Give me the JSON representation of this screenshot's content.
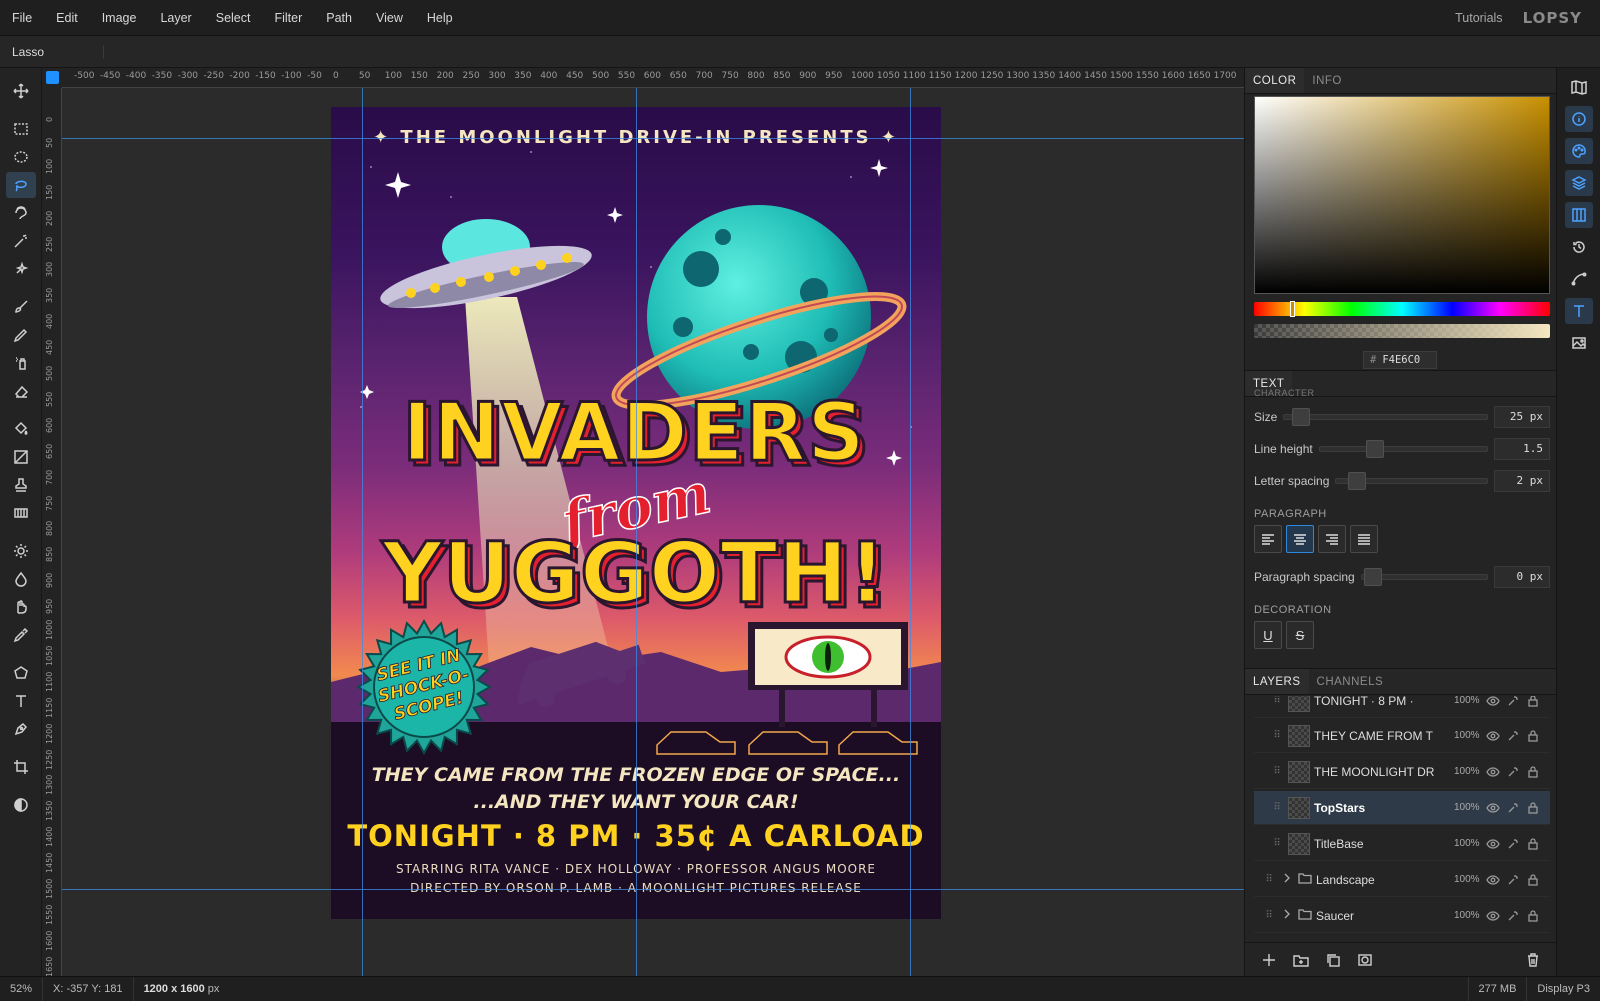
{
  "menubar": {
    "items": [
      "File",
      "Edit",
      "Image",
      "Layer",
      "Select",
      "Filter",
      "Path",
      "View",
      "Help"
    ],
    "tutorials": "Tutorials",
    "logo": "LOPSY"
  },
  "options": {
    "tool_name": "Lasso"
  },
  "rulers": {
    "h": [
      "-500",
      "-450",
      "-400",
      "-350",
      "-300",
      "-250",
      "-200",
      "-150",
      "-100",
      "-50",
      "0",
      "50",
      "100",
      "150",
      "200",
      "250",
      "300",
      "350",
      "400",
      "450",
      "500",
      "550",
      "600",
      "650",
      "700",
      "750",
      "800",
      "850",
      "900",
      "950",
      "1000",
      "1050",
      "1100",
      "1150",
      "1200",
      "1250",
      "1300",
      "1350",
      "1400",
      "1450",
      "1500",
      "1550",
      "1600",
      "1650",
      "1700"
    ],
    "v": [
      "0",
      "50",
      "100",
      "150",
      "200",
      "250",
      "300",
      "350",
      "400",
      "450",
      "500",
      "550",
      "600",
      "650",
      "700",
      "750",
      "800",
      "850",
      "900",
      "950",
      "1000",
      "1050",
      "1100",
      "1150",
      "1200",
      "1250",
      "1300",
      "1350",
      "1400",
      "1450",
      "1500",
      "1550",
      "1600",
      "1650"
    ]
  },
  "poster": {
    "presents": "✦ THE MOONLIGHT DRIVE-IN PRESENTS ✦",
    "title1": "INVADERS",
    "from": "from",
    "title2": "YUGGOTH!",
    "badge": [
      "SEE IT IN",
      "SHOCK-O-",
      "SCOPE!"
    ],
    "tag1": "THEY CAME FROM THE FROZEN EDGE OF SPACE...",
    "tag2": "...AND THEY WANT YOUR CAR!",
    "showtime": "TONIGHT · 8 PM · 35¢ A CARLOAD",
    "credits1": "STARRING RITA VANCE · DEX HOLLOWAY · PROFESSOR ANGUS MOORE",
    "credits2": "DIRECTED BY ORSON P. LAMB · A MOONLIGHT PICTURES RELEASE"
  },
  "color": {
    "tab_color": "COLOR",
    "tab_info": "INFO",
    "hex_label": "#",
    "hex": "F4E6C0"
  },
  "text": {
    "tab": "TEXT",
    "character": "CHARACTER",
    "size_label": "Size",
    "size": "25 px",
    "lh_label": "Line height",
    "lh": "1.5",
    "ls_label": "Letter spacing",
    "ls": "2 px",
    "paragraph": "PARAGRAPH",
    "ps_label": "Paragraph spacing",
    "ps": "0 px",
    "decoration": "DECORATION",
    "underline": "U",
    "strike": "S"
  },
  "layers": {
    "tab_layers": "LAYERS",
    "tab_channels": "CHANNELS",
    "items": [
      {
        "name": "TONIGHT · 8 PM ·",
        "opacity": "100%"
      },
      {
        "name": "THEY CAME FROM T",
        "opacity": "100%"
      },
      {
        "name": "THE MOONLIGHT DR",
        "opacity": "100%"
      },
      {
        "name": "TopStars",
        "opacity": "100%"
      },
      {
        "name": "TitleBase",
        "opacity": "100%"
      },
      {
        "name": "Landscape",
        "opacity": "100%"
      },
      {
        "name": "Saucer",
        "opacity": "100%"
      }
    ]
  },
  "status": {
    "zoom": "52%",
    "coords": "X: -357 Y: 181",
    "size": "1200 x 1600",
    "size_unit": "px",
    "memory": "277 MB",
    "profile": "Display P3"
  }
}
